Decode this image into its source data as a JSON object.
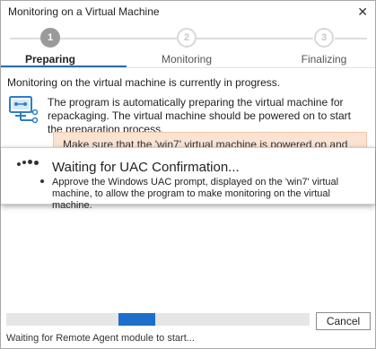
{
  "window": {
    "title": "Monitoring on a Virtual Machine",
    "close_glyph": "✕"
  },
  "steps": [
    {
      "number": "1",
      "label": "Preparing",
      "state": "active"
    },
    {
      "number": "2",
      "label": "Monitoring",
      "state": "inactive"
    },
    {
      "number": "3",
      "label": "Finalizing",
      "state": "inactive"
    }
  ],
  "status_line": "Monitoring on the virtual machine is currently in progress.",
  "info": {
    "icon": "virtual-machine-icon",
    "text": "The program is automatically preparing the virtual machine for repackaging. The virtual machine should be powered on to start the preparation process."
  },
  "warning": {
    "text": "Make sure that the 'win7' virtual machine is powered on and the 'localadmin' is logged on to the machine."
  },
  "overlay": {
    "title": "Waiting for UAC Confirmation...",
    "body": "Approve the Windows UAC prompt, displayed on the 'win7' virtual machine, to allow the program to make monitoring on the virtual machine."
  },
  "progress": {
    "kind": "marquee",
    "segment_start": 0.37,
    "segment_end": 0.49
  },
  "buttons": {
    "cancel": "Cancel"
  },
  "footer_status": "Waiting for Remote Agent module to start...",
  "colors": {
    "accent": "#2b6cb0",
    "progress": "#1e6fc9",
    "warning_bg": "#fbe3d2",
    "icon_blue": "#2a7fc9"
  }
}
